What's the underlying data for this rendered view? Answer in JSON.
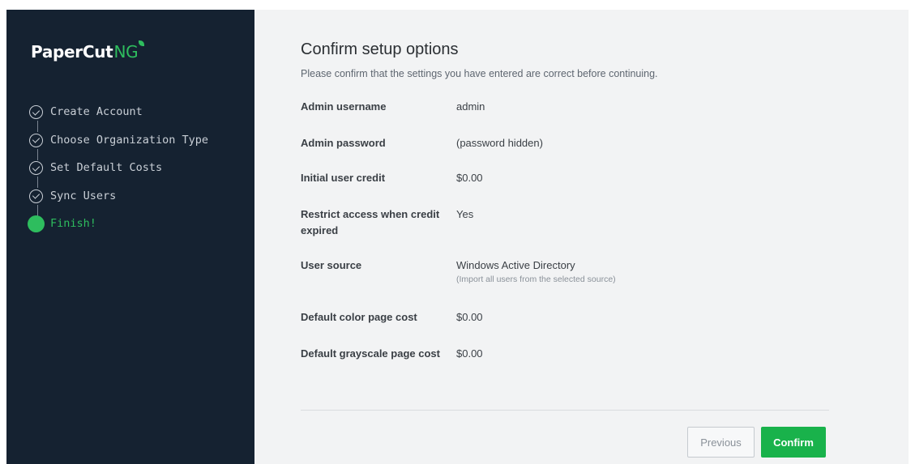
{
  "logo": {
    "brand": "PaperCut",
    "suffix": "NG"
  },
  "steps": [
    {
      "label": "Create Account",
      "state": "done"
    },
    {
      "label": "Choose Organization Type",
      "state": "done"
    },
    {
      "label": "Set Default Costs",
      "state": "done"
    },
    {
      "label": "Sync Users",
      "state": "done"
    },
    {
      "label": "Finish!",
      "state": "current"
    }
  ],
  "main": {
    "title": "Confirm setup options",
    "subtitle": "Please confirm that the settings you have entered are correct before continuing.",
    "rows": [
      {
        "label": "Admin username",
        "value": "admin"
      },
      {
        "label": "Admin password",
        "value": "(password hidden)"
      },
      {
        "label": "Initial user credit",
        "value": "$0.00"
      },
      {
        "label": "Restrict access when credit expired",
        "value": "Yes"
      },
      {
        "label": "User source",
        "value": "Windows Active Directory",
        "note": "(Import all users from the selected source)"
      },
      {
        "label": "Default color page cost",
        "value": "$0.00"
      },
      {
        "label": "Default grayscale page cost",
        "value": "$0.00"
      }
    ]
  },
  "buttons": {
    "previous": "Previous",
    "confirm": "Confirm"
  },
  "colors": {
    "sidebar_bg": "#152231",
    "accent_green": "#2ebd5e",
    "confirm_green": "#19b24b",
    "main_bg": "#f2f3f4"
  }
}
